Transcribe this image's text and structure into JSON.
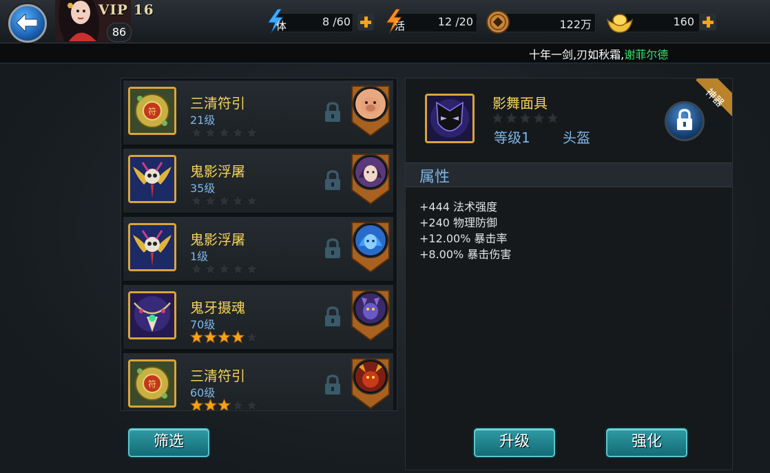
{
  "header": {
    "vip": "VIP 16",
    "player_level": "86",
    "stamina": {
      "label": "体",
      "value": "8 /60"
    },
    "vitality": {
      "label": "活",
      "value": "12 /20"
    },
    "coins": {
      "value": "122万"
    },
    "gold": {
      "value": "160"
    }
  },
  "ticker": {
    "text": "十年一剑,刃如秋霜,",
    "highlight": "谢菲尔德"
  },
  "items": [
    {
      "name": "三清符引",
      "level": "21级",
      "stars": 0,
      "icon": "talisman-icon",
      "hero": "boar-hero-icon"
    },
    {
      "name": "鬼影浮屠",
      "level": "35级",
      "stars": 0,
      "icon": "skull-wing-icon",
      "hero": "lady-hero-icon"
    },
    {
      "name": "鬼影浮屠",
      "level": "1级",
      "stars": 0,
      "icon": "skull-wing-icon",
      "hero": "blue-hair-hero-icon"
    },
    {
      "name": "鬼牙摄魂",
      "level": "70级",
      "stars": 4,
      "icon": "fang-necklace-icon",
      "hero": "demon-hero-icon"
    },
    {
      "name": "三清符引",
      "level": "60级",
      "stars": 3,
      "icon": "talisman-icon",
      "hero": "beast-hero-icon"
    }
  ],
  "detail": {
    "name": "影舞面具",
    "stars": 0,
    "level": "等级1",
    "slot": "头盔",
    "badge": "神器",
    "attr_title": "属性",
    "attributes": [
      "+444 法术强度",
      "+240 物理防御",
      "+12.00% 暴击率",
      "+8.00% 暴击伤害"
    ]
  },
  "buttons": {
    "filter": "筛选",
    "upgrade": "升级",
    "enhance": "强化"
  },
  "colors": {
    "gold_text": "#f5d35a",
    "blue_text": "#7fb6e8",
    "accent_orange": "#f6a21a",
    "button_teal": "#2f9aa3"
  }
}
